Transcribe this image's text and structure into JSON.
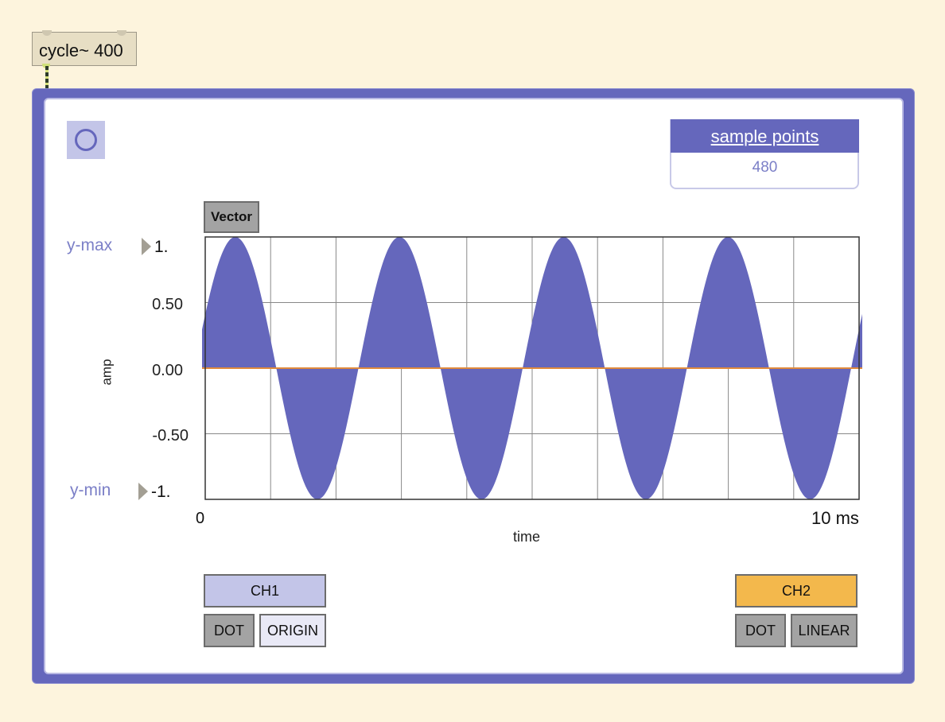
{
  "object_box": {
    "label": "cycle~ 400"
  },
  "toggle": {
    "state": "off",
    "icon": "circle-toggle-icon"
  },
  "sample_points": {
    "label": "sample points",
    "value": "480"
  },
  "vector_button": {
    "label": "Vector"
  },
  "y_controls": {
    "max_label": "y-max",
    "max_value": "1.",
    "min_label": "y-min",
    "min_value": "-1."
  },
  "chart_data": {
    "type": "area",
    "ylabel": "amp",
    "xlabel": "time",
    "x_start_label": "0",
    "x_end_label": "10 ms",
    "y_tick_labels": [
      "0.50",
      "0.00",
      "-0.50"
    ],
    "ylim": [
      -1,
      1
    ],
    "xlim": [
      0,
      10
    ],
    "x_unit": "ms",
    "signal": {
      "waveform": "sine",
      "frequency_hz": 400,
      "cycles_shown": 4,
      "amplitude": 1
    },
    "series": [
      {
        "color": "#6567bc"
      },
      {
        "color": "#e08a3c"
      }
    ],
    "grid": true,
    "grid_divisions_x": 10,
    "grid_divisions_y": 4
  },
  "channels": {
    "ch1": {
      "label": "CH1",
      "color": "#c3c5e8",
      "mode_button": "DOT",
      "aux_button": "ORIGIN"
    },
    "ch2": {
      "label": "CH2",
      "color": "#f3b84c",
      "mode_button": "DOT",
      "aux_button": "LINEAR"
    }
  },
  "colors": {
    "frame": "#6567bc",
    "background": "#fdf4dd",
    "trace": "#6567bc",
    "zero_line": "#e08a3c"
  }
}
